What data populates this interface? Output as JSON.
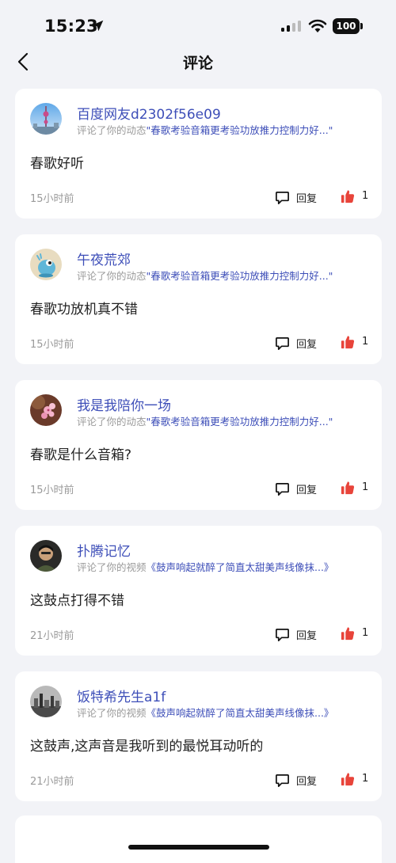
{
  "status": {
    "time": "15:23",
    "battery": "100"
  },
  "nav": {
    "title": "评论"
  },
  "comments": [
    {
      "user": "百度网友d2302f56e09",
      "meta_prefix": "评论了你的动态",
      "meta_link": "\"春歌考验音箱更考验功放推力控制力好...\"",
      "text": "春歌好听",
      "time": "15小时前",
      "reply": "回复",
      "likes": "1",
      "avatar": "tower"
    },
    {
      "user": "午夜荒郊",
      "meta_prefix": "评论了你的动态",
      "meta_link": "\"春歌考验音箱更考验功放推力控制力好...\"",
      "text": "春歌功放机真不错",
      "time": "15小时前",
      "reply": "回复",
      "likes": "1",
      "avatar": "blob"
    },
    {
      "user": "我是我陪你一场",
      "meta_prefix": "评论了你的动态",
      "meta_link": "\"春歌考验音箱更考验功放推力控制力好...\"",
      "text": "春歌是什么音箱?",
      "time": "15小时前",
      "reply": "回复",
      "likes": "1",
      "avatar": "flower"
    },
    {
      "user": "扑腾记忆",
      "meta_prefix": "评论了你的视频",
      "meta_link": "《鼓声响起就醉了简直太甜美声线像抹...》",
      "text": "这鼓点打得不错",
      "time": "21小时前",
      "reply": "回复",
      "likes": "1",
      "avatar": "person"
    },
    {
      "user": "饭特希先生a1f",
      "meta_prefix": "评论了你的视频",
      "meta_link": "《鼓声响起就醉了简直太甜美声线像抹...》",
      "text": "这鼓声,这声音是我听到的最悦耳动听的",
      "time": "21小时前",
      "reply": "回复",
      "likes": "1",
      "avatar": "city"
    }
  ],
  "colors": {
    "link": "#3d4eb8",
    "like": "#e8443a",
    "background": "#f2f3f7"
  }
}
